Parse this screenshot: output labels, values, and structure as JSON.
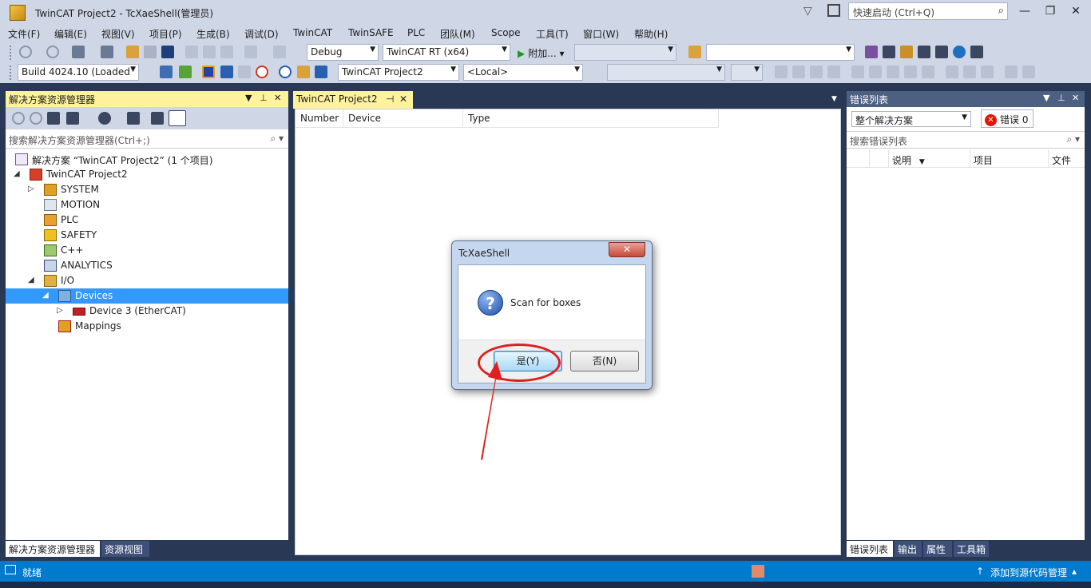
{
  "window": {
    "title": "TwinCAT Project2 - TcXaeShell(管理员)",
    "quick_launch_placeholder": "快速启动 (Ctrl+Q)",
    "minimize": "—",
    "restore": "❐",
    "close": "✕"
  },
  "menu": [
    "文件(F)",
    "编辑(E)",
    "视图(V)",
    "项目(P)",
    "生成(B)",
    "调试(D)",
    "TwinCAT",
    "TwinSAFE",
    "PLC",
    "团队(M)",
    "Scope",
    "工具(T)",
    "窗口(W)",
    "帮助(H)"
  ],
  "toolbar1": {
    "config": "Debug",
    "platform": "TwinCAT RT (x64)",
    "start_label": "附加...",
    "start_glyph": "▶"
  },
  "toolbar2": {
    "build": "Build 4024.10 (Loaded",
    "project": "TwinCAT Project2",
    "target": "<Local>"
  },
  "solution_explorer": {
    "title": "解决方案资源管理器",
    "search_placeholder": "搜索解决方案资源管理器(Ctrl+;)",
    "tree": [
      {
        "label": "解决方案 “TwinCAT Project2” (1 个项目)",
        "twist": ""
      },
      {
        "label": "TwinCAT Project2",
        "twist": "◢"
      },
      {
        "label": "SYSTEM",
        "twist": "▷"
      },
      {
        "label": "MOTION",
        "twist": ""
      },
      {
        "label": "PLC",
        "twist": ""
      },
      {
        "label": "SAFETY",
        "twist": ""
      },
      {
        "label": "C++",
        "twist": ""
      },
      {
        "label": "ANALYTICS",
        "twist": ""
      },
      {
        "label": "I/O",
        "twist": "◢"
      },
      {
        "label": "Devices",
        "twist": "◢"
      },
      {
        "label": "Device 3 (EtherCAT)",
        "twist": "▷"
      },
      {
        "label": "Mappings",
        "twist": ""
      }
    ],
    "bottom_tabs": [
      "解决方案资源管理器",
      "资源视图"
    ]
  },
  "document": {
    "tab_title": "TwinCAT Project2",
    "tab_pin": "⊣",
    "tab_close": "✕",
    "columns": [
      "Number",
      "Device",
      "Type"
    ]
  },
  "error_list": {
    "title": "错误列表",
    "scope": "整个解决方案",
    "errors_label": "错误 0",
    "search_placeholder": "搜索错误列表",
    "columns": [
      "说明",
      "项目",
      "文件"
    ],
    "bottom_tabs": [
      "错误列表",
      "输出",
      "属性",
      "工具箱"
    ]
  },
  "statusbar": {
    "status": "就绪",
    "source_control": "添加到源代码管理"
  },
  "dialog": {
    "title": "TcXaeShell",
    "message": "Scan for boxes",
    "yes": "是(Y)",
    "no": "否(N)",
    "close": "✕",
    "icon": "?"
  },
  "colors": {
    "active_header": "#fff29d",
    "chrome": "#cfd6e5",
    "frame": "#293955",
    "status": "#007acc",
    "selection": "#3399ff",
    "annotation": "#e02020"
  }
}
